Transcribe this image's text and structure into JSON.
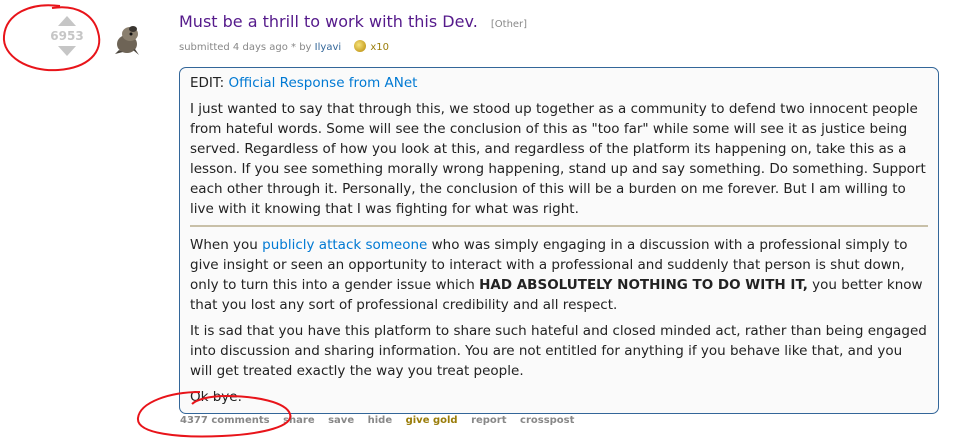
{
  "post": {
    "score": "6953",
    "title": "Must be a thrill to work with this Dev.",
    "flair": "[Other]",
    "tagline": {
      "prefix": "submitted 4 days ago * by",
      "author": "Ilyavi",
      "gold_count": "x10"
    },
    "selftext": {
      "edit_prefix": "EDIT: ",
      "edit_link": "Official Response from ANet",
      "p1": "I just wanted to say that through this, we stood up together as a community to defend two innocent people from hateful words. Some will see the conclusion of this as \"too far\" while some will see it as justice being served. Regardless of how you look at this, and regardless of the platform its happening on, take this as a lesson. If you see something morally wrong happening, stand up and say something. Do something. Support each other through it. Personally, the conclusion of this will be a burden on me forever. But I am willing to live with it knowing that I was fighting for what was right.",
      "p2_a": "When you ",
      "p2_link": "publicly attack someone",
      "p2_b": " who was simply engaging in a discussion with a professional simply to give insight or seen an opportunity to interact with a professional and suddenly that person is shut down, only to turn this into a gender issue which ",
      "p2_bold": "HAD ABSOLUTELY NOTHING TO DO WITH IT,",
      "p2_c": " you better know that you lost any sort of professional credibility and all respect.",
      "p3": "It is sad that you have this platform to share such hateful and closed minded act, rather than being engaged into discussion and sharing information. You are not entitled for anything if you behave like that, and you will get treated exactly the way you treat people.",
      "p4": "Ok bye."
    },
    "buttons": {
      "comments": "4377 comments",
      "share": "share",
      "save": "save",
      "hide": "hide",
      "give_gold": "give gold",
      "report": "report",
      "crosspost": "crosspost"
    }
  },
  "colors": {
    "title": "#551a8b",
    "link": "#0079d3",
    "annotation": "#e8141a",
    "gold": "#9a7d0a"
  },
  "icons": [
    "upvote-arrow",
    "downvote-arrow",
    "avatar-creature",
    "gold-coin"
  ]
}
